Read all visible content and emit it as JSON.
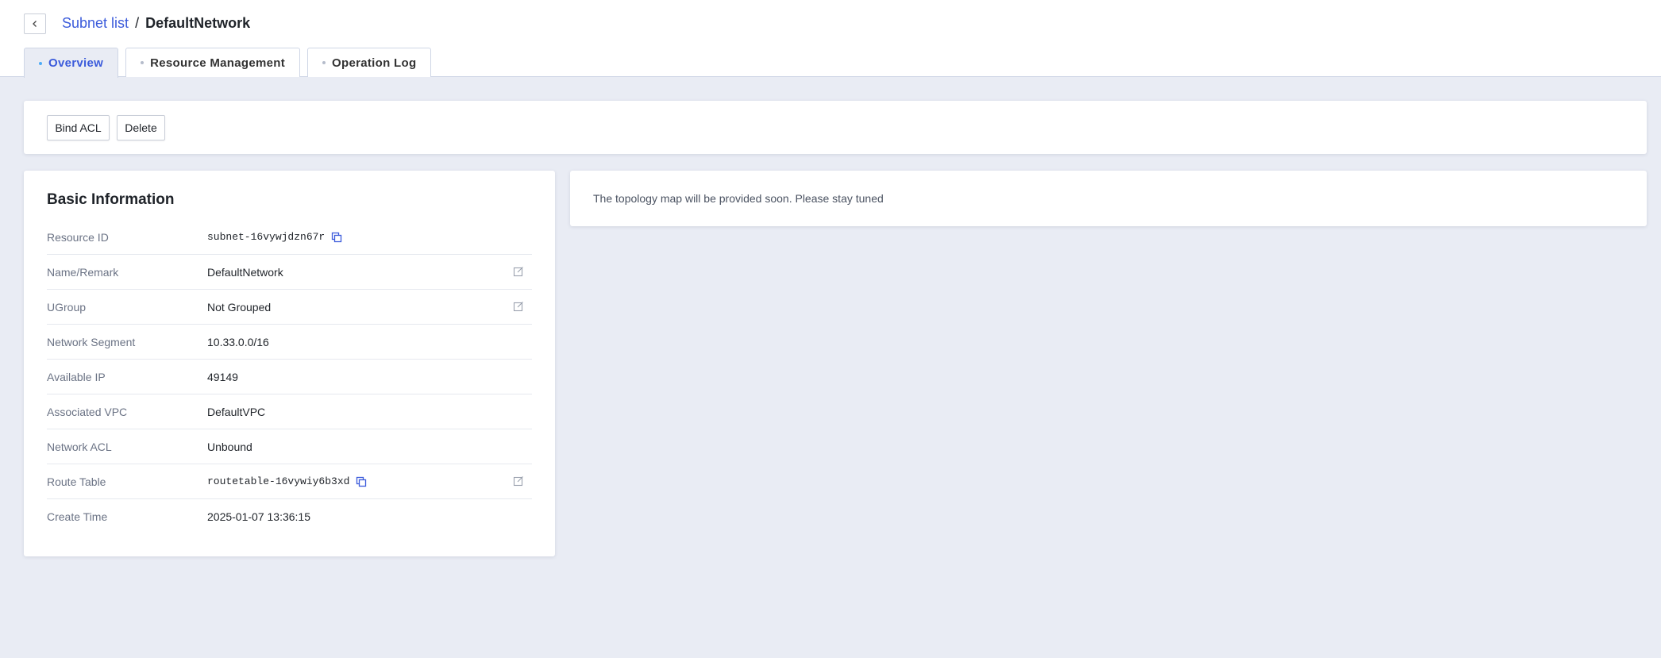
{
  "breadcrumb": {
    "parent": "Subnet list",
    "separator": "/",
    "current": "DefaultNetwork"
  },
  "tabs": [
    {
      "label": "Overview",
      "active": true
    },
    {
      "label": "Resource Management",
      "active": false
    },
    {
      "label": "Operation Log",
      "active": false
    }
  ],
  "actions": {
    "bind_acl": "Bind ACL",
    "delete": "Delete"
  },
  "basic_info": {
    "title": "Basic Information",
    "rows": [
      {
        "label": "Resource ID",
        "value": "subnet-16vywjdzn67r",
        "mono": true,
        "copy": true,
        "edit": false
      },
      {
        "label": "Name/Remark",
        "value": "DefaultNetwork",
        "mono": false,
        "copy": false,
        "edit": true
      },
      {
        "label": "UGroup",
        "value": "Not Grouped",
        "mono": false,
        "copy": false,
        "edit": true
      },
      {
        "label": "Network Segment",
        "value": "10.33.0.0/16",
        "mono": false,
        "copy": false,
        "edit": false
      },
      {
        "label": "Available IP",
        "value": "49149",
        "mono": false,
        "copy": false,
        "edit": false
      },
      {
        "label": "Associated VPC",
        "value": "DefaultVPC",
        "mono": false,
        "copy": false,
        "edit": false
      },
      {
        "label": "Network ACL",
        "value": "Unbound",
        "mono": false,
        "copy": false,
        "edit": false
      },
      {
        "label": "Route Table",
        "value": "routetable-16vywiy6b3xd",
        "mono": true,
        "copy": true,
        "edit": true
      },
      {
        "label": "Create Time",
        "value": "2025-01-07 13:36:15",
        "mono": false,
        "copy": false,
        "edit": false
      }
    ]
  },
  "topology": {
    "message": "The topology map will be provided soon. Please stay tuned"
  },
  "colors": {
    "accent": "#3b5bdb",
    "background": "#e9ecf4",
    "active_dot": "#4dabf7"
  },
  "icons": {
    "back": "chevron-left-icon",
    "copy": "copy-icon",
    "edit": "edit-icon"
  }
}
